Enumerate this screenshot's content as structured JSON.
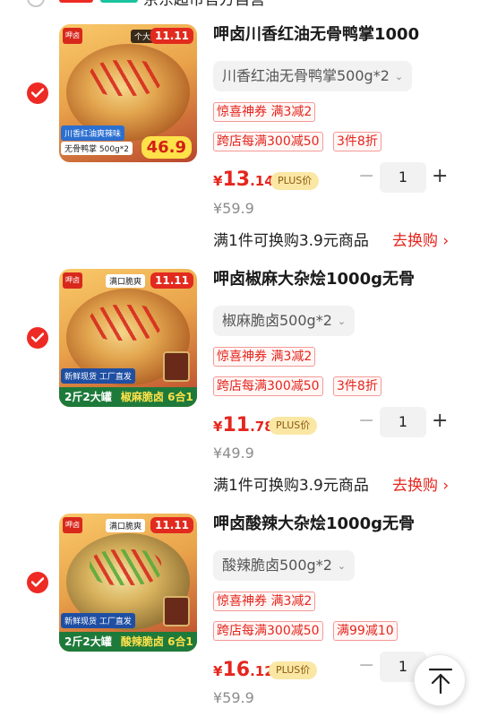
{
  "header": {
    "text": "京东超市官方自营"
  },
  "accent": "#e5261e",
  "items": [
    {
      "title": "呷卤川香红油无骨鸭掌1000",
      "variant": "川香红油无骨鸭掌500g*2",
      "thumb": {
        "top_band": "个大肉多",
        "tag": "11.11",
        "logo": "呷卤",
        "banner1": "川香红油爽辣味",
        "banner2": "无骨鸭掌 500g*2",
        "price_bubble": "46.9"
      },
      "promos": [
        "惊喜神券 满3减2",
        "跨店每满300减50",
        "3件8折"
      ],
      "price": {
        "currency": "¥",
        "integer": "13",
        "decimal": ".14",
        "plus": "PLUS价"
      },
      "qty": "1",
      "original_price": "¥59.9",
      "exchange_text": "满1件可换购3.9元商品",
      "exchange_link": "去换购 ›"
    },
    {
      "title": "呷卤椒麻大杂烩1000g无骨",
      "variant": "椒麻脆卤500g*2",
      "thumb": {
        "top_band": "满口脆爽",
        "tag": "11.11",
        "logo": "呷卤",
        "banner1": "新鲜现货 工厂直发",
        "banner2": "2斤2大罐",
        "green_text": "椒麻脆卤 6合1"
      },
      "promos": [
        "惊喜神券 满3减2",
        "跨店每满300减50",
        "3件8折"
      ],
      "price": {
        "currency": "¥",
        "integer": "11",
        "decimal": ".78",
        "plus": "PLUS价"
      },
      "qty": "1",
      "original_price": "¥49.9",
      "exchange_text": "满1件可换购3.9元商品",
      "exchange_link": "去换购 ›"
    },
    {
      "title": "呷卤酸辣大杂烩1000g无骨",
      "variant": "酸辣脆卤500g*2",
      "thumb": {
        "top_band": "满口脆爽",
        "tag": "11.11",
        "logo": "呷卤",
        "banner1": "新鲜现货 工厂直发",
        "banner2": "2斤2大罐",
        "green_text": "酸辣脆卤 6合1"
      },
      "promos": [
        "惊喜神券 满3减2",
        "跨店每满300减50",
        "满99减10"
      ],
      "price": {
        "currency": "¥",
        "integer": "16",
        "decimal": ".12",
        "plus": "PLUS价"
      },
      "qty": "1",
      "original_price": "¥59.9"
    }
  ]
}
